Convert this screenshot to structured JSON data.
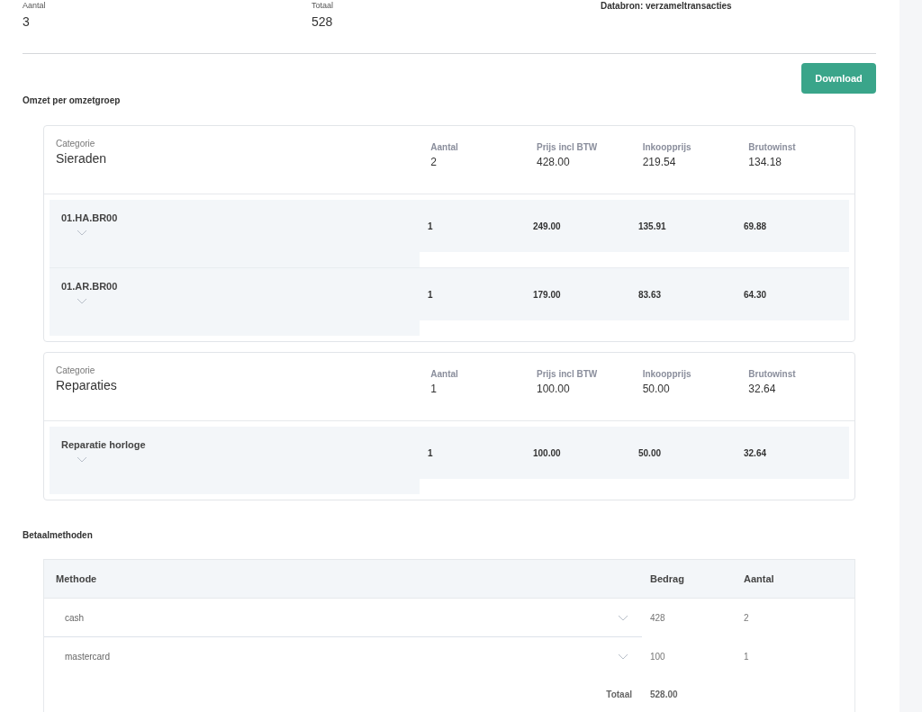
{
  "summary": [
    {
      "label": "Aantal",
      "value": "3"
    },
    {
      "label": "Totaal",
      "value": "528"
    }
  ],
  "data_source": "Databron: verzameltransacties",
  "download_button": "Download",
  "revenue": {
    "title": "Omzet per omzetgroep",
    "categories": [
      {
        "columns": [
          "Categorie",
          "Aantal",
          "Prijs incl BTW",
          "Inkoopprijs",
          "Brutowinst"
        ],
        "values": [
          "Sieraden",
          "2",
          "428.00",
          "219.54",
          "134.18"
        ],
        "items": [
          {
            "name": "01.HA.BR00",
            "values": [
              "1",
              "249.00",
              "135.91",
              "69.88"
            ]
          },
          {
            "name": "01.AR.BR00",
            "values": [
              "1",
              "179.00",
              "83.63",
              "64.30"
            ]
          }
        ]
      },
      {
        "columns": [
          "Categorie",
          "Aantal",
          "Prijs incl BTW",
          "Inkoopprijs",
          "Brutowinst"
        ],
        "values": [
          "Reparaties",
          "1",
          "100.00",
          "50.00",
          "32.64"
        ],
        "items": [
          {
            "name": "Reparatie horloge",
            "values": [
              "1",
              "100.00",
              "50.00",
              "32.64"
            ]
          }
        ]
      }
    ]
  },
  "payments": {
    "title": "Betaalmethoden",
    "columns": [
      "Methode",
      "Bedrag",
      "Aantal"
    ],
    "rows": [
      {
        "method": "cash",
        "amount": "428",
        "count": "2"
      },
      {
        "method": "mastercard",
        "amount": "100",
        "count": "1"
      }
    ],
    "total_label": "Totaal",
    "total": "528.00"
  }
}
